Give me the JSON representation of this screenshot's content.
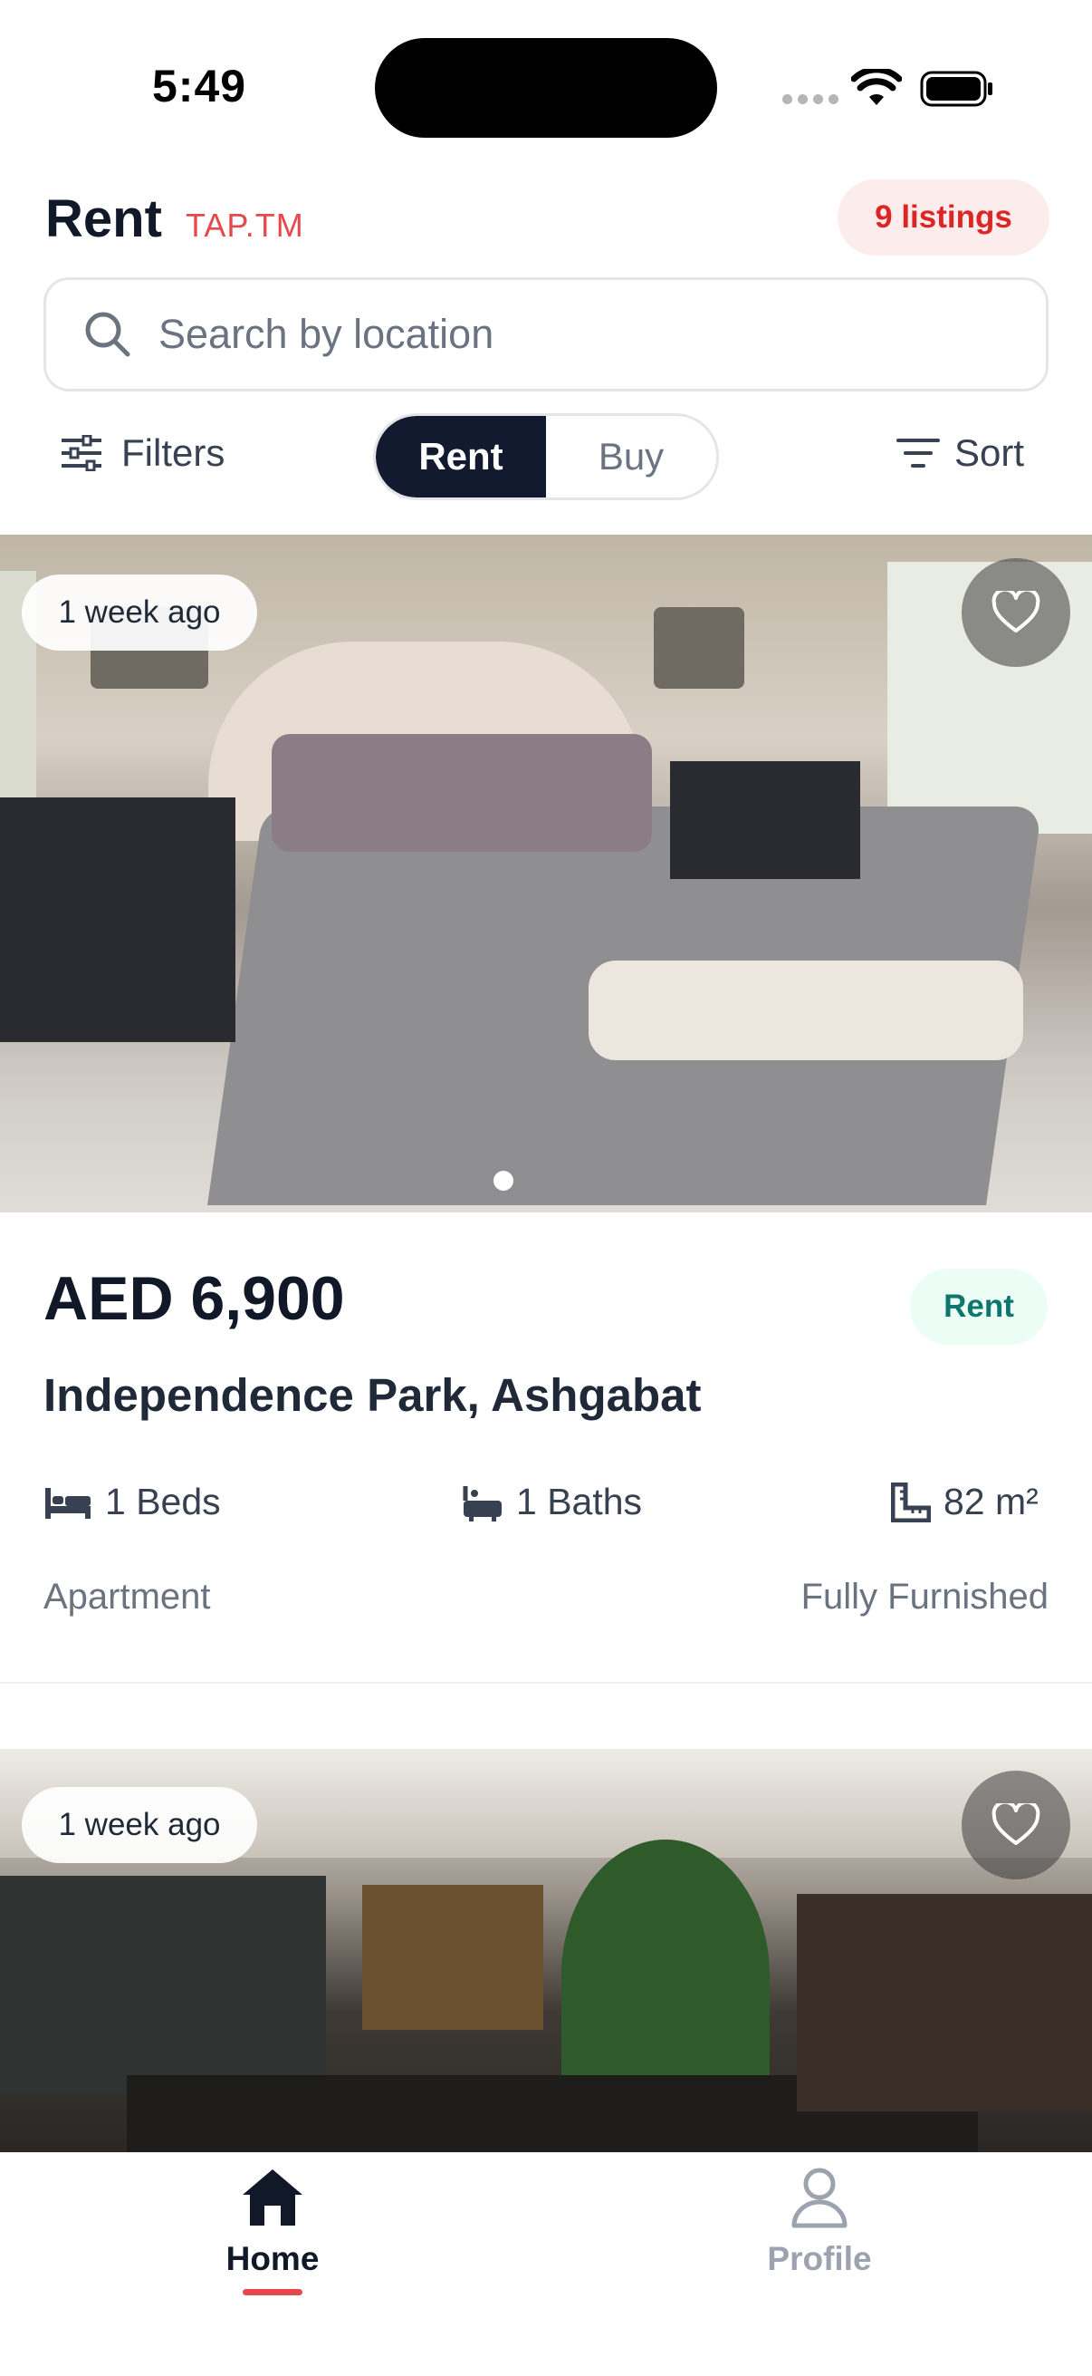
{
  "status_bar": {
    "time": "5:49"
  },
  "header": {
    "title": "Rent",
    "brand": "TAP.TM",
    "listings_count": "9 listings"
  },
  "search": {
    "placeholder": "Search by location",
    "value": ""
  },
  "toolbar": {
    "filters_label": "Filters",
    "segments": [
      "Rent",
      "Buy"
    ],
    "selected_segment": "Rent",
    "sort_label": "Sort"
  },
  "listings": [
    {
      "posted": "1 week ago",
      "price": "AED 6,900",
      "type_badge": "Rent",
      "location": "Independence Park, Ashgabat",
      "beds": "1 Beds",
      "baths": "1 Baths",
      "area": "82 m²",
      "property_type": "Apartment",
      "furnishing": "Fully Furnished",
      "favorite": false
    },
    {
      "posted": "1 week ago",
      "favorite": false
    }
  ],
  "tab_bar": {
    "home_label": "Home",
    "profile_label": "Profile",
    "active": "Home"
  },
  "colors": {
    "accent": "#e5484d",
    "segment_active": "#111a2e",
    "rent_badge_text": "#0f766e",
    "rent_badge_bg": "#ecfdf5"
  },
  "icons": [
    "search-icon",
    "filters-icon",
    "sort-icon",
    "heart-icon",
    "bed-icon",
    "bath-icon",
    "ruler-icon",
    "home-icon",
    "profile-icon",
    "wifi-icon",
    "battery-icon"
  ]
}
